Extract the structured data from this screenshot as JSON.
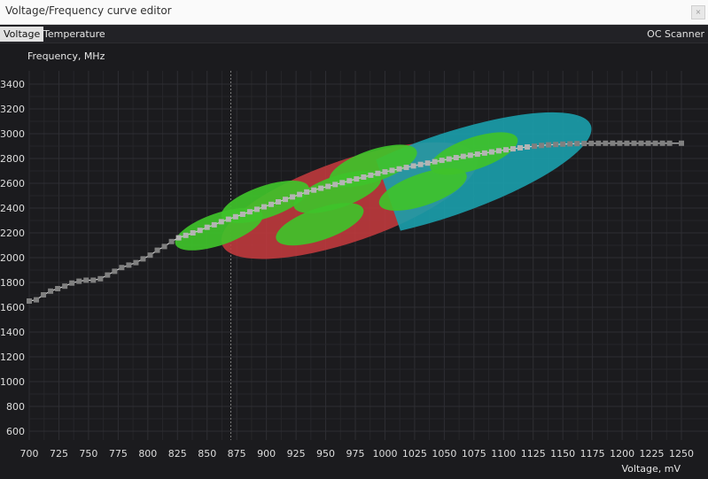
{
  "window": {
    "title": "Voltage/Frequency curve editor",
    "close_glyph": "×"
  },
  "tabs": [
    {
      "label": "Voltage",
      "active": true
    },
    {
      "label": "Temperature",
      "active": false
    }
  ],
  "oc_scanner_label": "OC Scanner",
  "colors": {
    "background": "#1b1b1e",
    "grid": "#2e2e33",
    "curve": "#9a9a9a",
    "point": "#808080",
    "selected_point": "#b4b4b4",
    "red_zone": "#c33a3e",
    "cyan_zone": "#1ba0ac",
    "green_blob": "#3fc22a"
  },
  "chart_data": {
    "type": "line",
    "xlabel": "Voltage, mV",
    "ylabel": "Frequency, MHz",
    "xlim": [
      700,
      1250
    ],
    "ylim": [
      600,
      3400
    ],
    "x_ticks": [
      700,
      725,
      750,
      775,
      800,
      825,
      850,
      875,
      900,
      925,
      950,
      975,
      1000,
      1025,
      1050,
      1075,
      1100,
      1125,
      1150,
      1175,
      1200,
      1225,
      1250
    ],
    "y_ticks": [
      600,
      800,
      1000,
      1200,
      1400,
      1600,
      1800,
      2000,
      2200,
      2400,
      2600,
      2800,
      3000,
      3200,
      3400
    ],
    "cursor_x": 870,
    "points": [
      [
        700,
        1650
      ],
      [
        706,
        1660
      ],
      [
        712,
        1700
      ],
      [
        718,
        1730
      ],
      [
        724,
        1750
      ],
      [
        730,
        1770
      ],
      [
        736,
        1795
      ],
      [
        742,
        1810
      ],
      [
        748,
        1818
      ],
      [
        754,
        1818
      ],
      [
        760,
        1830
      ],
      [
        766,
        1860
      ],
      [
        772,
        1890
      ],
      [
        778,
        1920
      ],
      [
        784,
        1940
      ],
      [
        790,
        1960
      ],
      [
        796,
        1990
      ],
      [
        802,
        2020
      ],
      [
        808,
        2060
      ],
      [
        814,
        2090
      ],
      [
        820,
        2130
      ],
      [
        826,
        2160
      ],
      [
        832,
        2180
      ],
      [
        838,
        2200
      ],
      [
        844,
        2220
      ],
      [
        850,
        2245
      ],
      [
        856,
        2265
      ],
      [
        862,
        2290
      ],
      [
        868,
        2310
      ],
      [
        874,
        2330
      ],
      [
        880,
        2350
      ],
      [
        886,
        2370
      ],
      [
        892,
        2390
      ],
      [
        898,
        2410
      ],
      [
        904,
        2430
      ],
      [
        910,
        2450
      ],
      [
        916,
        2470
      ],
      [
        922,
        2490
      ],
      [
        928,
        2510
      ],
      [
        934,
        2530
      ],
      [
        940,
        2545
      ],
      [
        946,
        2560
      ],
      [
        952,
        2575
      ],
      [
        958,
        2590
      ],
      [
        964,
        2605
      ],
      [
        970,
        2620
      ],
      [
        976,
        2635
      ],
      [
        982,
        2650
      ],
      [
        988,
        2665
      ],
      [
        994,
        2680
      ],
      [
        1000,
        2692
      ],
      [
        1006,
        2704
      ],
      [
        1012,
        2716
      ],
      [
        1018,
        2728
      ],
      [
        1024,
        2740
      ],
      [
        1030,
        2752
      ],
      [
        1036,
        2763
      ],
      [
        1042,
        2774
      ],
      [
        1048,
        2785
      ],
      [
        1054,
        2796
      ],
      [
        1060,
        2807
      ],
      [
        1066,
        2817
      ],
      [
        1072,
        2826
      ],
      [
        1078,
        2835
      ],
      [
        1084,
        2844
      ],
      [
        1090,
        2853
      ],
      [
        1096,
        2862
      ],
      [
        1102,
        2870
      ],
      [
        1108,
        2878
      ],
      [
        1114,
        2886
      ],
      [
        1120,
        2893
      ],
      [
        1126,
        2899
      ],
      [
        1132,
        2905
      ],
      [
        1138,
        2910
      ],
      [
        1144,
        2913
      ],
      [
        1150,
        2916
      ],
      [
        1156,
        2918
      ],
      [
        1162,
        2920
      ],
      [
        1168,
        2921
      ],
      [
        1174,
        2922
      ],
      [
        1180,
        2923
      ],
      [
        1186,
        2923
      ],
      [
        1192,
        2923
      ],
      [
        1198,
        2923
      ],
      [
        1204,
        2923
      ],
      [
        1210,
        2923
      ],
      [
        1216,
        2923
      ],
      [
        1222,
        2923
      ],
      [
        1228,
        2923
      ],
      [
        1234,
        2923
      ],
      [
        1240,
        2923
      ],
      [
        1250,
        2923
      ]
    ],
    "selected_range": [
      826,
      1125
    ],
    "zones": [
      {
        "kind": "red",
        "center": [
          970,
          2460
        ],
        "rx": 152,
        "ry": 46,
        "rotate": -19
      },
      {
        "kind": "cyan",
        "center": [
          1050,
          2660
        ],
        "rx": 175,
        "ry": 46,
        "rotate": -19
      },
      {
        "kind": "green",
        "center": [
          990,
          2740
        ],
        "rx": 52,
        "ry": 18,
        "rotate": -19
      },
      {
        "kind": "green",
        "center": [
          1075,
          2840
        ],
        "rx": 52,
        "ry": 18,
        "rotate": -19
      },
      {
        "kind": "green",
        "center": [
          899,
          2450
        ],
        "rx": 52,
        "ry": 18,
        "rotate": -19
      },
      {
        "kind": "green",
        "center": [
          960,
          2530
        ],
        "rx": 52,
        "ry": 18,
        "rotate": -19
      },
      {
        "kind": "green",
        "center": [
          1032,
          2550
        ],
        "rx": 52,
        "ry": 18,
        "rotate": -19
      },
      {
        "kind": "green",
        "center": [
          860,
          2230
        ],
        "rx": 52,
        "ry": 18,
        "rotate": -19
      },
      {
        "kind": "green",
        "center": [
          945,
          2270
        ],
        "rx": 52,
        "ry": 18,
        "rotate": -19
      }
    ]
  }
}
